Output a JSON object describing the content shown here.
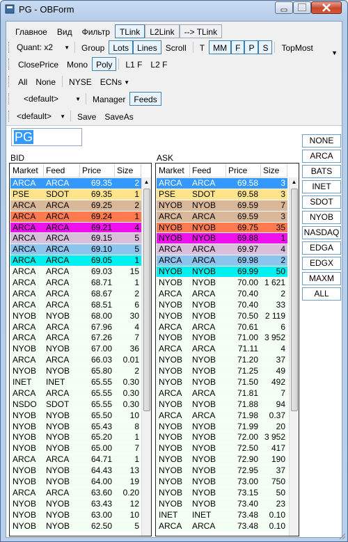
{
  "window": {
    "title": "PG - OBForm"
  },
  "menu": {
    "items": [
      "Главное",
      "Вид",
      "Фильтр"
    ],
    "toggles": [
      {
        "label": "TLink",
        "active": true
      },
      {
        "label": "L2Link",
        "active": false
      },
      {
        "label": "--> TLink",
        "active": false
      }
    ]
  },
  "toolbar1": {
    "quant": "Quant: x2",
    "group": "Group",
    "lots": "Lots",
    "lines": "Lines",
    "scroll": "Scroll",
    "t": "T",
    "mm": "MM",
    "f": "F",
    "p": "P",
    "s": "S",
    "topmost": "TopMost"
  },
  "toolbar2": {
    "close_price": "ClosePrice",
    "mono": "Mono",
    "poly": "Poly",
    "l1f": "L1 F",
    "l2f": "L2 F"
  },
  "toolbar3": {
    "all": "All",
    "none": "None",
    "nyse": "NYSE",
    "ecns": "ECNs",
    "ecns_arrow": "▼"
  },
  "toolbar4": {
    "default": "<default>",
    "manager": "Manager",
    "feeds": "Feeds"
  },
  "toolbar5": {
    "default": "<default>",
    "save": "Save",
    "save_as": "SaveAs"
  },
  "symbol": {
    "value": "PG"
  },
  "bid": {
    "label": "BID",
    "columns": [
      "Market",
      "Feed",
      "Price",
      "Size"
    ],
    "rows": [
      [
        "ARCA",
        "ARCA",
        "69.35",
        "2",
        "#3399ff",
        "#ffffff"
      ],
      [
        "PSE",
        "SDOT",
        "69.35",
        "1",
        "#ffe48c",
        "#000000"
      ],
      [
        "ARCA",
        "ARCA",
        "69.25",
        "2",
        "#d9b89a",
        "#000000"
      ],
      [
        "ARCA",
        "ARCA",
        "69.24",
        "1",
        "#ff7a4f",
        "#000000"
      ],
      [
        "ARCA",
        "ARCA",
        "69.21",
        "4",
        "#ee11ee",
        "#000000"
      ],
      [
        "ARCA",
        "ARCA",
        "69.15",
        "5",
        "#d8c0dc",
        "#000000"
      ],
      [
        "ARCA",
        "ARCA",
        "69.10",
        "5",
        "#8bc4ec",
        "#000000"
      ],
      [
        "ARCA",
        "ARCA",
        "69.05",
        "1",
        "#00f0f0",
        "#000000"
      ],
      [
        "ARCA",
        "ARCA",
        "69.03",
        "15",
        "",
        ""
      ],
      [
        "ARCA",
        "ARCA",
        "68.71",
        "1",
        "",
        ""
      ],
      [
        "ARCA",
        "ARCA",
        "68.67",
        "2",
        "",
        ""
      ],
      [
        "ARCA",
        "ARCA",
        "68.51",
        "6",
        "",
        ""
      ],
      [
        "NYOB",
        "NYOB",
        "68.00",
        "30",
        "",
        ""
      ],
      [
        "ARCA",
        "ARCA",
        "67.96",
        "4",
        "",
        ""
      ],
      [
        "ARCA",
        "ARCA",
        "67.26",
        "7",
        "",
        ""
      ],
      [
        "NYOB",
        "NYOB",
        "67.00",
        "36",
        "",
        ""
      ],
      [
        "ARCA",
        "ARCA",
        "66.03",
        "0.01",
        "",
        ""
      ],
      [
        "NYOB",
        "NYOB",
        "65.80",
        "2",
        "",
        ""
      ],
      [
        "INET",
        "INET",
        "65.55",
        "0.30",
        "",
        ""
      ],
      [
        "ARCA",
        "ARCA",
        "65.55",
        "0.30",
        "",
        ""
      ],
      [
        "NSDO",
        "SDOT",
        "65.55",
        "0.30",
        "",
        ""
      ],
      [
        "NYOB",
        "NYOB",
        "65.50",
        "10",
        "",
        ""
      ],
      [
        "NYOB",
        "NYOB",
        "65.43",
        "8",
        "",
        ""
      ],
      [
        "NYOB",
        "NYOB",
        "65.20",
        "1",
        "",
        ""
      ],
      [
        "NYOB",
        "NYOB",
        "65.00",
        "7",
        "",
        ""
      ],
      [
        "ARCA",
        "ARCA",
        "64.71",
        "1",
        "",
        ""
      ],
      [
        "NYOB",
        "NYOB",
        "64.43",
        "13",
        "",
        ""
      ],
      [
        "NYOB",
        "NYOB",
        "64.00",
        "19",
        "",
        ""
      ],
      [
        "ARCA",
        "ARCA",
        "63.60",
        "0.20",
        "",
        ""
      ],
      [
        "NYOB",
        "NYOB",
        "63.43",
        "12",
        "",
        ""
      ],
      [
        "NYOB",
        "NYOB",
        "63.00",
        "10",
        "",
        ""
      ],
      [
        "NYOB",
        "NYOB",
        "62.50",
        "5",
        "",
        ""
      ]
    ]
  },
  "ask": {
    "label": "ASK",
    "columns": [
      "Market",
      "Feed",
      "Price",
      "Size"
    ],
    "rows": [
      [
        "ARCA",
        "ARCA",
        "69.58",
        "3",
        "#3399ff",
        "#ffffff"
      ],
      [
        "PSE",
        "SDOT",
        "69.58",
        "3",
        "#ffe48c",
        "#000000"
      ],
      [
        "NYOB",
        "NYOB",
        "69.59",
        "7",
        "#d9b89a",
        "#000000"
      ],
      [
        "ARCA",
        "ARCA",
        "69.59",
        "3",
        "#d9b89a",
        "#000000"
      ],
      [
        "NYOB",
        "NYOB",
        "69.75",
        "35",
        "#ff7a4f",
        "#000000"
      ],
      [
        "NYOB",
        "NYOB",
        "69.88",
        "1",
        "#ee11ee",
        "#000000"
      ],
      [
        "ARCA",
        "ARCA",
        "69.97",
        "4",
        "#d8c0dc",
        "#000000"
      ],
      [
        "ARCA",
        "ARCA",
        "69.98",
        "2",
        "#8bc4ec",
        "#000000"
      ],
      [
        "NYOB",
        "NYOB",
        "69.99",
        "50",
        "#00f0f0",
        "#000000"
      ],
      [
        "NYOB",
        "NYOB",
        "70.00",
        "1 621",
        "",
        ""
      ],
      [
        "ARCA",
        "ARCA",
        "70.40",
        "2",
        "",
        ""
      ],
      [
        "NYOB",
        "NYOB",
        "70.40",
        "33",
        "",
        ""
      ],
      [
        "NYOB",
        "NYOB",
        "70.50",
        "2 119",
        "",
        ""
      ],
      [
        "ARCA",
        "ARCA",
        "70.61",
        "6",
        "",
        ""
      ],
      [
        "NYOB",
        "NYOB",
        "71.00",
        "3 952",
        "",
        ""
      ],
      [
        "ARCA",
        "ARCA",
        "71.11",
        "4",
        "",
        ""
      ],
      [
        "NYOB",
        "NYOB",
        "71.20",
        "37",
        "",
        ""
      ],
      [
        "NYOB",
        "NYOB",
        "71.25",
        "49",
        "",
        ""
      ],
      [
        "NYOB",
        "NYOB",
        "71.50",
        "492",
        "",
        ""
      ],
      [
        "ARCA",
        "ARCA",
        "71.81",
        "7",
        "",
        ""
      ],
      [
        "NYOB",
        "NYOB",
        "71.88",
        "94",
        "",
        ""
      ],
      [
        "ARCA",
        "ARCA",
        "71.98",
        "0.37",
        "",
        ""
      ],
      [
        "NYOB",
        "NYOB",
        "71.99",
        "20",
        "",
        ""
      ],
      [
        "NYOB",
        "NYOB",
        "72.00",
        "3 952",
        "",
        ""
      ],
      [
        "NYOB",
        "NYOB",
        "72.50",
        "417",
        "",
        ""
      ],
      [
        "NYOB",
        "NYOB",
        "72.90",
        "190",
        "",
        ""
      ],
      [
        "NYOB",
        "NYOB",
        "72.95",
        "37",
        "",
        ""
      ],
      [
        "NYOB",
        "NYOB",
        "73.00",
        "750",
        "",
        ""
      ],
      [
        "NYOB",
        "NYOB",
        "73.15",
        "50",
        "",
        ""
      ],
      [
        "NYOB",
        "NYOB",
        "73.40",
        "23",
        "",
        ""
      ],
      [
        "INET",
        "INET",
        "73.48",
        "0.10",
        "",
        ""
      ],
      [
        "ARCA",
        "ARCA",
        "73.48",
        "0.10",
        "",
        ""
      ]
    ]
  },
  "feeds": [
    "NONE",
    "ARCA",
    "BATS",
    "INET",
    "SDOT",
    "NYOB",
    "NASDAQ",
    "EDGA",
    "EDGX",
    "MAXM",
    "ALL"
  ]
}
